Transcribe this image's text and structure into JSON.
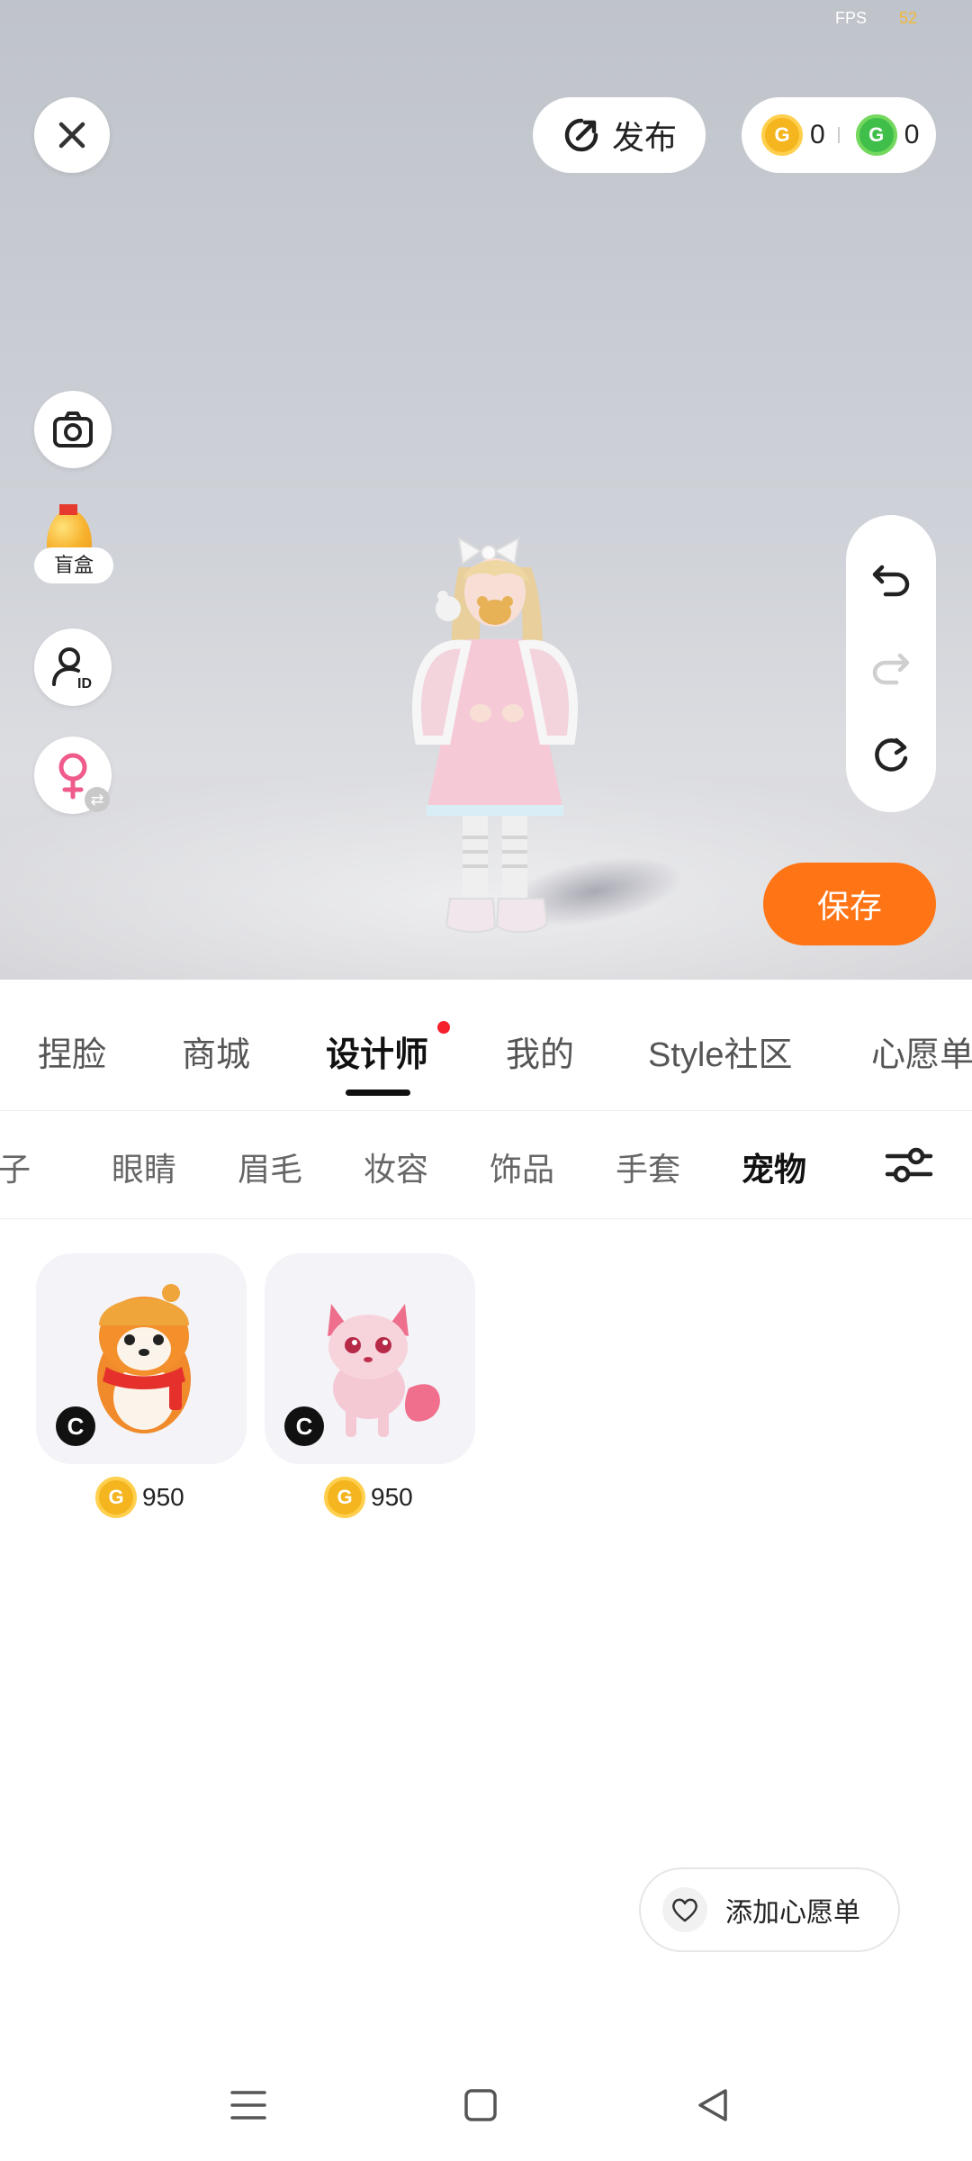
{
  "status": {
    "fps_label": "FPS",
    "fps_value": "52"
  },
  "header": {
    "publish_label": "发布",
    "currencies": [
      {
        "icon": "gold-g-coin-icon",
        "value": "0"
      },
      {
        "icon": "green-g-coin-icon",
        "value": "0"
      }
    ]
  },
  "side_tools": {
    "camera": "camera-icon",
    "blind_box_label": "盲盒",
    "avatar_id": "user-id-icon",
    "gender": "female-icon"
  },
  "history": {
    "undo": "undo-icon",
    "redo": "redo-icon",
    "reset": "reset-icon"
  },
  "save_label": "保存",
  "main_tabs": [
    {
      "label": "捏脸"
    },
    {
      "label": "商城"
    },
    {
      "label": "设计师",
      "active": true,
      "has_dot": true
    },
    {
      "label": "我的"
    },
    {
      "label": "Style社区"
    },
    {
      "label": "心愿单"
    }
  ],
  "sub_tabs": [
    {
      "label": "鞋子"
    },
    {
      "label": "眼睛"
    },
    {
      "label": "眉毛"
    },
    {
      "label": "妆容"
    },
    {
      "label": "饰品"
    },
    {
      "label": "手套"
    },
    {
      "label": "宠物",
      "active": true
    }
  ],
  "items": [
    {
      "name_icon": "shiba-pet-icon",
      "creator_badge": "C",
      "price": "950"
    },
    {
      "name_icon": "pink-fox-pet-icon",
      "creator_badge": "C",
      "price": "950"
    }
  ],
  "wishlist_label": "添加心愿单",
  "colors": {
    "accent": "#ff7414",
    "gold": "#f4b51e",
    "green": "#3fbf4a",
    "dot": "#f5222d"
  }
}
